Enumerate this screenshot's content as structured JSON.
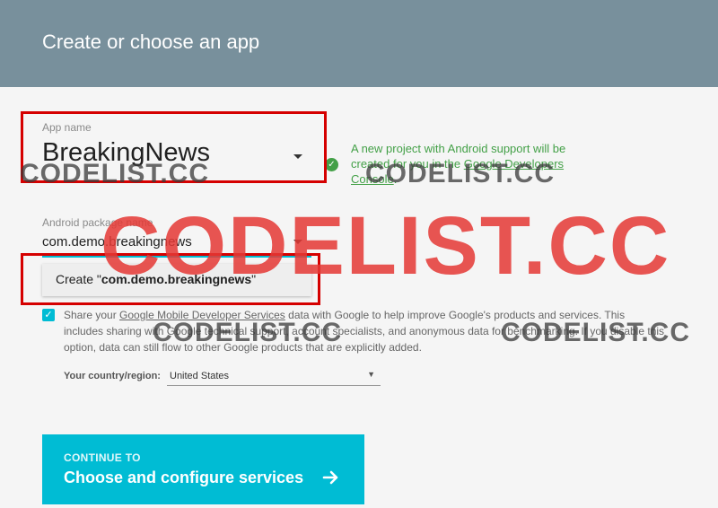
{
  "header": {
    "title": "Create or choose an app"
  },
  "app_name": {
    "label": "App name",
    "value": "BreakingNews"
  },
  "project_note": {
    "text_before": "A new project with Android support will be created for you in the ",
    "link": "Google Developers Console",
    "text_after": "."
  },
  "package": {
    "label": "Android package name",
    "value": "com.demo.breakingnews",
    "suggestion_prefix": "Create \"",
    "suggestion_value": "com.demo.breakingnews",
    "suggestion_suffix": "\""
  },
  "share": {
    "text_before": "Share your ",
    "link": "Google Mobile Developer Services",
    "text_after": " data with Google to help improve Google's products and services. This includes sharing with Google technical support, account specialists, and anonymous data for benchmarking. If you disable this option, data can still flow to other Google products that are explicitly added.",
    "checked": true
  },
  "country": {
    "label": "Your country/region:",
    "value": "United States"
  },
  "continue": {
    "small": "CONTINUE TO",
    "big": "Choose and configure services"
  },
  "watermarks": {
    "big": "CODELIST.CC",
    "small": "CODELIST.CC"
  },
  "colors": {
    "header": "#78909c",
    "accent": "#00bcd4",
    "success": "#43a047",
    "highlight": "#d50000"
  }
}
